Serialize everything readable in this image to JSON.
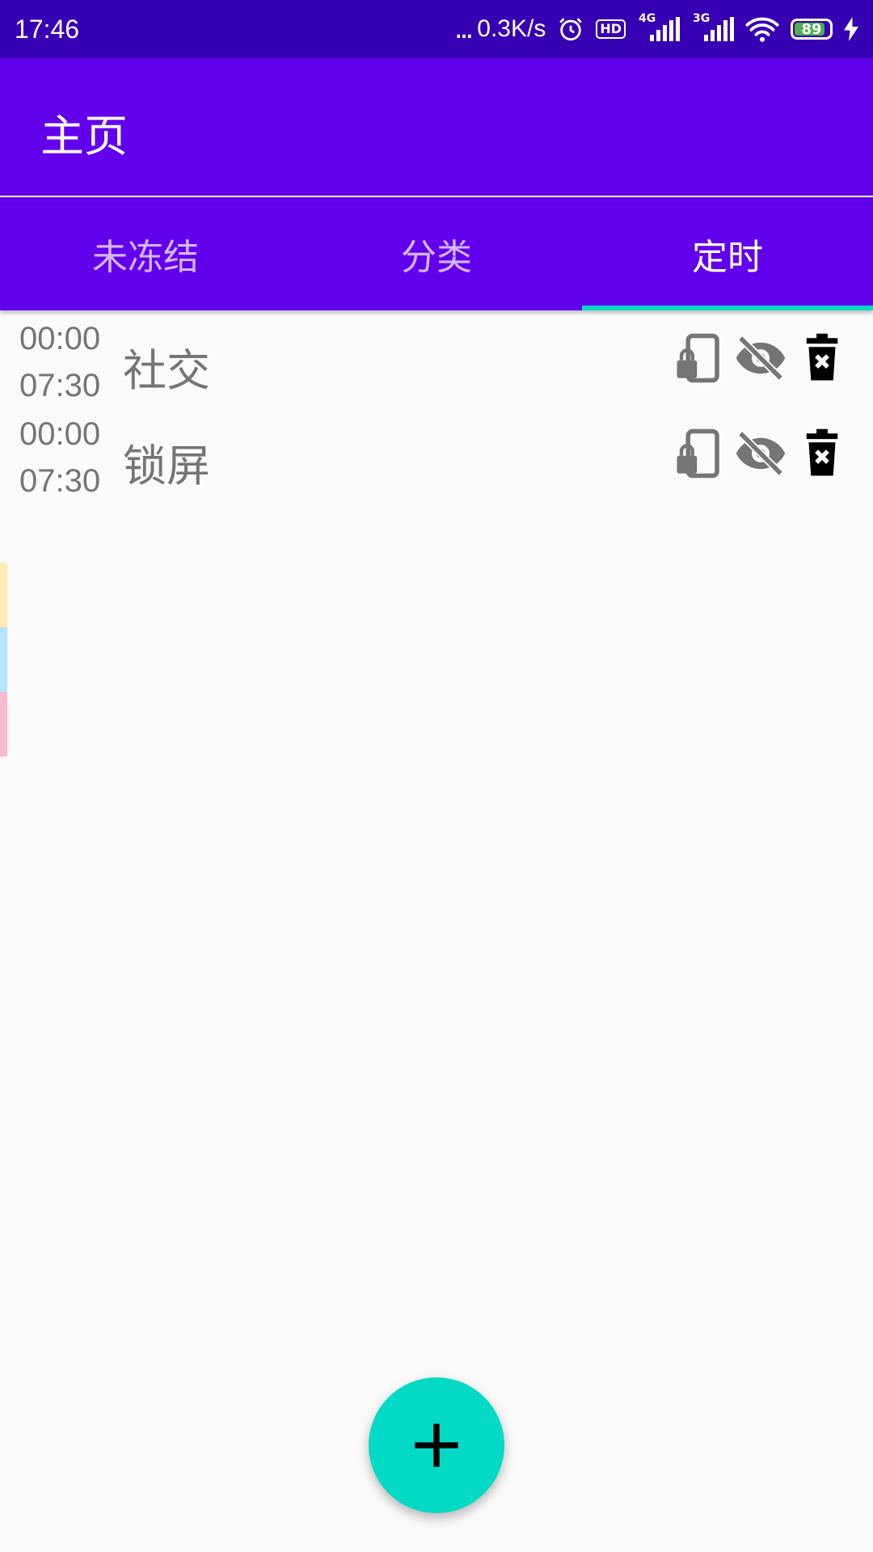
{
  "status_bar": {
    "time": "17:46",
    "dots": "...",
    "speed": "0.3K/s",
    "hd": "HD",
    "net1": "4G",
    "net2": "3G",
    "battery": "89"
  },
  "app_bar": {
    "title": "主页"
  },
  "tabs": [
    {
      "label": "未冻结",
      "active": false
    },
    {
      "label": "分类",
      "active": false
    },
    {
      "label": "定时",
      "active": true
    }
  ],
  "schedules": [
    {
      "start": "00:00",
      "end": "07:30",
      "name": "社交"
    },
    {
      "start": "00:00",
      "end": "07:30",
      "name": "锁屏"
    }
  ],
  "icons": {
    "lock": "phone-lock-icon",
    "hide": "eye-off-icon",
    "delete": "delete-icon",
    "add": "plus-icon"
  },
  "colors": {
    "status_bar": "#3700b3",
    "primary": "#6200ee",
    "accent": "#03dac5",
    "text_secondary": "#757575",
    "strip_colors": [
      "#ffecb3",
      "#b3e5fc",
      "#f8bbd0"
    ]
  }
}
